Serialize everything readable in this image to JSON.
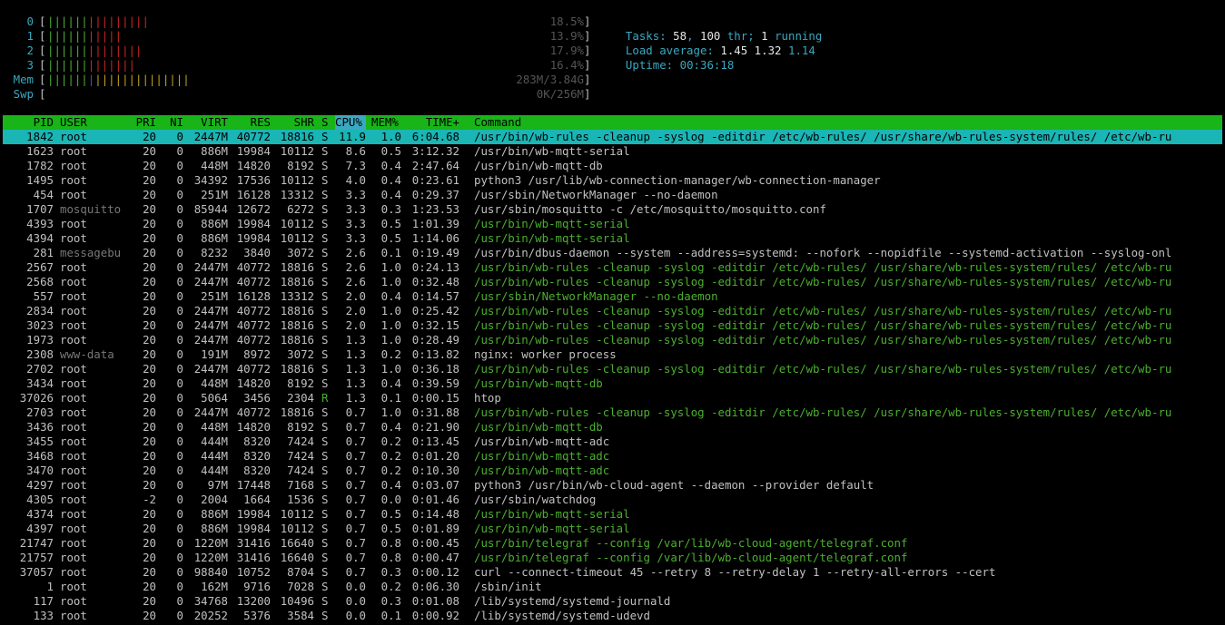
{
  "meters": [
    {
      "label": "0",
      "value": "18.5%",
      "green": 6,
      "red": 9
    },
    {
      "label": "1",
      "value": "13.9%",
      "green": 6,
      "red": 5
    },
    {
      "label": "2",
      "value": "17.9%",
      "green": 6,
      "red": 8
    },
    {
      "label": "3",
      "value": "16.4%",
      "green": 6,
      "red": 7
    },
    {
      "label": "Mem",
      "value": "283M/3.84G",
      "green": 6,
      "blue": 1,
      "yellow": 14
    },
    {
      "label": "Swp",
      "value": "0K/256M",
      "green": 0
    }
  ],
  "summary": {
    "tasks_label": "Tasks: ",
    "tasks": "58",
    "thr_sep": ", ",
    "thr": "100",
    "thr_label": " thr; ",
    "running": "1",
    "running_label": " running",
    "load_label": "Load average: ",
    "load1": "1.45",
    "load5": "1.32",
    "load15": "1.14",
    "uptime_label": "Uptime: ",
    "uptime": "00:36:18"
  },
  "columns": {
    "pid": "PID",
    "user": "USER",
    "pri": "PRI",
    "ni": "NI",
    "virt": "VIRT",
    "res": "RES",
    "shr": "SHR",
    "s": "S",
    "cpu": "CPU%",
    "mem": "MEM%",
    "time": "TIME+",
    "cmd": "Command"
  },
  "processes": [
    {
      "pid": "1842",
      "user": "root",
      "pri": "20",
      "ni": "0",
      "virt": "2447M",
      "res": "40772",
      "shr": "18816",
      "s": "S",
      "cpu": "11.9",
      "mem": "1.0",
      "time": "6:04.68",
      "cmd": "/usr/bin/wb-rules -cleanup -syslog -editdir /etc/wb-rules/ /usr/share/wb-rules-system/rules/ /etc/wb-ru",
      "sel": true,
      "thread": false
    },
    {
      "pid": "1623",
      "user": "root",
      "pri": "20",
      "ni": "0",
      "virt": "886M",
      "res": "19984",
      "shr": "10112",
      "s": "S",
      "cpu": "8.6",
      "mem": "0.5",
      "time": "3:12.32",
      "cmd": "/usr/bin/wb-mqtt-serial",
      "thread": false
    },
    {
      "pid": "1782",
      "user": "root",
      "pri": "20",
      "ni": "0",
      "virt": "448M",
      "res": "14820",
      "shr": "8192",
      "s": "S",
      "cpu": "7.3",
      "mem": "0.4",
      "time": "2:47.64",
      "cmd": "/usr/bin/wb-mqtt-db",
      "thread": false
    },
    {
      "pid": "1495",
      "user": "root",
      "pri": "20",
      "ni": "0",
      "virt": "34392",
      "res": "17536",
      "shr": "10112",
      "s": "S",
      "cpu": "4.0",
      "mem": "0.4",
      "time": "0:23.61",
      "cmd": "python3 /usr/lib/wb-connection-manager/wb-connection-manager",
      "thread": false
    },
    {
      "pid": "454",
      "user": "root",
      "pri": "20",
      "ni": "0",
      "virt": "251M",
      "res": "16128",
      "shr": "13312",
      "s": "S",
      "cpu": "3.3",
      "mem": "0.4",
      "time": "0:29.37",
      "cmd": "/usr/sbin/NetworkManager --no-daemon",
      "thread": false
    },
    {
      "pid": "1707",
      "user": "mosquitto",
      "pri": "20",
      "ni": "0",
      "virt": "85944",
      "res": "12672",
      "shr": "6272",
      "s": "S",
      "cpu": "3.3",
      "mem": "0.3",
      "time": "1:23.53",
      "cmd": "/usr/sbin/mosquitto -c /etc/mosquitto/mosquitto.conf",
      "thread": false,
      "dimuser": true
    },
    {
      "pid": "4393",
      "user": "root",
      "pri": "20",
      "ni": "0",
      "virt": "886M",
      "res": "19984",
      "shr": "10112",
      "s": "S",
      "cpu": "3.3",
      "mem": "0.5",
      "time": "1:01.39",
      "cmd": "/usr/bin/wb-mqtt-serial",
      "thread": true
    },
    {
      "pid": "4394",
      "user": "root",
      "pri": "20",
      "ni": "0",
      "virt": "886M",
      "res": "19984",
      "shr": "10112",
      "s": "S",
      "cpu": "3.3",
      "mem": "0.5",
      "time": "1:14.06",
      "cmd": "/usr/bin/wb-mqtt-serial",
      "thread": true
    },
    {
      "pid": "281",
      "user": "messagebu",
      "pri": "20",
      "ni": "0",
      "virt": "8232",
      "res": "3840",
      "shr": "3072",
      "s": "S",
      "cpu": "2.6",
      "mem": "0.1",
      "time": "0:19.49",
      "cmd": "/usr/bin/dbus-daemon --system --address=systemd: --nofork --nopidfile --systemd-activation --syslog-onl",
      "thread": false,
      "dimuser": true
    },
    {
      "pid": "2567",
      "user": "root",
      "pri": "20",
      "ni": "0",
      "virt": "2447M",
      "res": "40772",
      "shr": "18816",
      "s": "S",
      "cpu": "2.6",
      "mem": "1.0",
      "time": "0:24.13",
      "cmd": "/usr/bin/wb-rules -cleanup -syslog -editdir /etc/wb-rules/ /usr/share/wb-rules-system/rules/ /etc/wb-ru",
      "thread": true
    },
    {
      "pid": "2568",
      "user": "root",
      "pri": "20",
      "ni": "0",
      "virt": "2447M",
      "res": "40772",
      "shr": "18816",
      "s": "S",
      "cpu": "2.6",
      "mem": "1.0",
      "time": "0:32.48",
      "cmd": "/usr/bin/wb-rules -cleanup -syslog -editdir /etc/wb-rules/ /usr/share/wb-rules-system/rules/ /etc/wb-ru",
      "thread": true
    },
    {
      "pid": "557",
      "user": "root",
      "pri": "20",
      "ni": "0",
      "virt": "251M",
      "res": "16128",
      "shr": "13312",
      "s": "S",
      "cpu": "2.0",
      "mem": "0.4",
      "time": "0:14.57",
      "cmd": "/usr/sbin/NetworkManager --no-daemon",
      "thread": true
    },
    {
      "pid": "2834",
      "user": "root",
      "pri": "20",
      "ni": "0",
      "virt": "2447M",
      "res": "40772",
      "shr": "18816",
      "s": "S",
      "cpu": "2.0",
      "mem": "1.0",
      "time": "0:25.42",
      "cmd": "/usr/bin/wb-rules -cleanup -syslog -editdir /etc/wb-rules/ /usr/share/wb-rules-system/rules/ /etc/wb-ru",
      "thread": true
    },
    {
      "pid": "3023",
      "user": "root",
      "pri": "20",
      "ni": "0",
      "virt": "2447M",
      "res": "40772",
      "shr": "18816",
      "s": "S",
      "cpu": "2.0",
      "mem": "1.0",
      "time": "0:32.15",
      "cmd": "/usr/bin/wb-rules -cleanup -syslog -editdir /etc/wb-rules/ /usr/share/wb-rules-system/rules/ /etc/wb-ru",
      "thread": true
    },
    {
      "pid": "1973",
      "user": "root",
      "pri": "20",
      "ni": "0",
      "virt": "2447M",
      "res": "40772",
      "shr": "18816",
      "s": "S",
      "cpu": "1.3",
      "mem": "1.0",
      "time": "0:28.49",
      "cmd": "/usr/bin/wb-rules -cleanup -syslog -editdir /etc/wb-rules/ /usr/share/wb-rules-system/rules/ /etc/wb-ru",
      "thread": true
    },
    {
      "pid": "2308",
      "user": "www-data",
      "pri": "20",
      "ni": "0",
      "virt": "191M",
      "res": "8972",
      "shr": "3072",
      "s": "S",
      "cpu": "1.3",
      "mem": "0.2",
      "time": "0:13.82",
      "cmd": "nginx: worker process",
      "thread": false,
      "dimuser": true
    },
    {
      "pid": "2702",
      "user": "root",
      "pri": "20",
      "ni": "0",
      "virt": "2447M",
      "res": "40772",
      "shr": "18816",
      "s": "S",
      "cpu": "1.3",
      "mem": "1.0",
      "time": "0:36.18",
      "cmd": "/usr/bin/wb-rules -cleanup -syslog -editdir /etc/wb-rules/ /usr/share/wb-rules-system/rules/ /etc/wb-ru",
      "thread": true
    },
    {
      "pid": "3434",
      "user": "root",
      "pri": "20",
      "ni": "0",
      "virt": "448M",
      "res": "14820",
      "shr": "8192",
      "s": "S",
      "cpu": "1.3",
      "mem": "0.4",
      "time": "0:39.59",
      "cmd": "/usr/bin/wb-mqtt-db",
      "thread": true
    },
    {
      "pid": "37026",
      "user": "root",
      "pri": "20",
      "ni": "0",
      "virt": "5064",
      "res": "3456",
      "shr": "2304",
      "s": "R",
      "cpu": "1.3",
      "mem": "0.1",
      "time": "0:00.15",
      "cmd": "htop",
      "thread": false,
      "running": true
    },
    {
      "pid": "2703",
      "user": "root",
      "pri": "20",
      "ni": "0",
      "virt": "2447M",
      "res": "40772",
      "shr": "18816",
      "s": "S",
      "cpu": "0.7",
      "mem": "1.0",
      "time": "0:31.88",
      "cmd": "/usr/bin/wb-rules -cleanup -syslog -editdir /etc/wb-rules/ /usr/share/wb-rules-system/rules/ /etc/wb-ru",
      "thread": true
    },
    {
      "pid": "3436",
      "user": "root",
      "pri": "20",
      "ni": "0",
      "virt": "448M",
      "res": "14820",
      "shr": "8192",
      "s": "S",
      "cpu": "0.7",
      "mem": "0.4",
      "time": "0:21.90",
      "cmd": "/usr/bin/wb-mqtt-db",
      "thread": true
    },
    {
      "pid": "3455",
      "user": "root",
      "pri": "20",
      "ni": "0",
      "virt": "444M",
      "res": "8320",
      "shr": "7424",
      "s": "S",
      "cpu": "0.7",
      "mem": "0.2",
      "time": "0:13.45",
      "cmd": "/usr/bin/wb-mqtt-adc",
      "thread": false
    },
    {
      "pid": "3468",
      "user": "root",
      "pri": "20",
      "ni": "0",
      "virt": "444M",
      "res": "8320",
      "shr": "7424",
      "s": "S",
      "cpu": "0.7",
      "mem": "0.2",
      "time": "0:01.20",
      "cmd": "/usr/bin/wb-mqtt-adc",
      "thread": true
    },
    {
      "pid": "3470",
      "user": "root",
      "pri": "20",
      "ni": "0",
      "virt": "444M",
      "res": "8320",
      "shr": "7424",
      "s": "S",
      "cpu": "0.7",
      "mem": "0.2",
      "time": "0:10.30",
      "cmd": "/usr/bin/wb-mqtt-adc",
      "thread": true
    },
    {
      "pid": "4297",
      "user": "root",
      "pri": "20",
      "ni": "0",
      "virt": "97M",
      "res": "17448",
      "shr": "7168",
      "s": "S",
      "cpu": "0.7",
      "mem": "0.4",
      "time": "0:03.07",
      "cmd": "python3 /usr/bin/wb-cloud-agent --daemon --provider default",
      "thread": false
    },
    {
      "pid": "4305",
      "user": "root",
      "pri": "-2",
      "ni": "0",
      "virt": "2004",
      "res": "1664",
      "shr": "1536",
      "s": "S",
      "cpu": "0.7",
      "mem": "0.0",
      "time": "0:01.46",
      "cmd": "/usr/sbin/watchdog",
      "thread": false
    },
    {
      "pid": "4374",
      "user": "root",
      "pri": "20",
      "ni": "0",
      "virt": "886M",
      "res": "19984",
      "shr": "10112",
      "s": "S",
      "cpu": "0.7",
      "mem": "0.5",
      "time": "0:14.48",
      "cmd": "/usr/bin/wb-mqtt-serial",
      "thread": true
    },
    {
      "pid": "4397",
      "user": "root",
      "pri": "20",
      "ni": "0",
      "virt": "886M",
      "res": "19984",
      "shr": "10112",
      "s": "S",
      "cpu": "0.7",
      "mem": "0.5",
      "time": "0:01.89",
      "cmd": "/usr/bin/wb-mqtt-serial",
      "thread": true
    },
    {
      "pid": "21747",
      "user": "root",
      "pri": "20",
      "ni": "0",
      "virt": "1220M",
      "res": "31416",
      "shr": "16640",
      "s": "S",
      "cpu": "0.7",
      "mem": "0.8",
      "time": "0:00.45",
      "cmd": "/usr/bin/telegraf --config /var/lib/wb-cloud-agent/telegraf.conf",
      "thread": true
    },
    {
      "pid": "21757",
      "user": "root",
      "pri": "20",
      "ni": "0",
      "virt": "1220M",
      "res": "31416",
      "shr": "16640",
      "s": "S",
      "cpu": "0.7",
      "mem": "0.8",
      "time": "0:00.47",
      "cmd": "/usr/bin/telegraf --config /var/lib/wb-cloud-agent/telegraf.conf",
      "thread": true
    },
    {
      "pid": "37057",
      "user": "root",
      "pri": "20",
      "ni": "0",
      "virt": "98840",
      "res": "10752",
      "shr": "8704",
      "s": "S",
      "cpu": "0.7",
      "mem": "0.3",
      "time": "0:00.12",
      "cmd": "curl --connect-timeout 45 --retry 8 --retry-delay 1 --retry-all-errors --cert",
      "thread": false
    },
    {
      "pid": "1",
      "user": "root",
      "pri": "20",
      "ni": "0",
      "virt": "162M",
      "res": "9716",
      "shr": "7028",
      "s": "S",
      "cpu": "0.0",
      "mem": "0.2",
      "time": "0:06.30",
      "cmd": "/sbin/init",
      "thread": false
    },
    {
      "pid": "117",
      "user": "root",
      "pri": "20",
      "ni": "0",
      "virt": "34768",
      "res": "13200",
      "shr": "10496",
      "s": "S",
      "cpu": "0.0",
      "mem": "0.3",
      "time": "0:01.08",
      "cmd": "/lib/systemd/systemd-journald",
      "thread": false
    },
    {
      "pid": "133",
      "user": "root",
      "pri": "20",
      "ni": "0",
      "virt": "20252",
      "res": "5376",
      "shr": "3584",
      "s": "S",
      "cpu": "0.0",
      "mem": "0.1",
      "time": "0:00.92",
      "cmd": "/lib/systemd/systemd-udevd",
      "thread": false
    }
  ],
  "colors": {
    "header_bg": "#18b418",
    "selected_bg": "#1ab5b5",
    "accent": "#3aa8c1",
    "thread": "#4caf2f"
  }
}
